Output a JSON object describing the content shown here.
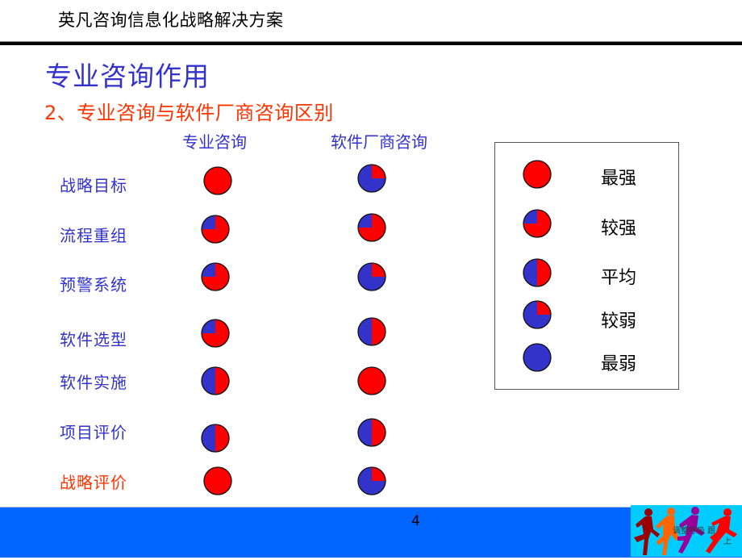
{
  "header": {
    "title": "英凡咨询信息化战略解决方案"
  },
  "slide": {
    "title": "专业咨询作用",
    "subtitle": "2、专业咨询与软件厂商咨询区别"
  },
  "comparison": {
    "columns": [
      "专业咨询",
      "软件厂商咨询"
    ],
    "rows": [
      {
        "label": "战略目标",
        "highlight": false,
        "ratings": [
          "最强",
          "较弱"
        ]
      },
      {
        "label": "流程重组",
        "highlight": false,
        "ratings": [
          "较强",
          "较强"
        ]
      },
      {
        "label": "预警系统",
        "highlight": false,
        "ratings": [
          "较强",
          "较弱"
        ]
      },
      {
        "label": "软件选型",
        "highlight": false,
        "ratings": [
          "较强",
          "平均"
        ]
      },
      {
        "label": "软件实施",
        "highlight": false,
        "ratings": [
          "平均",
          "最强"
        ]
      },
      {
        "label": "项目评价",
        "highlight": false,
        "ratings": [
          "平均",
          "平均"
        ]
      },
      {
        "label": "战略评价",
        "highlight": true,
        "ratings": [
          "最强",
          "较弱"
        ]
      }
    ]
  },
  "legend": {
    "items": [
      {
        "label": "最强",
        "red_fraction": 1.0
      },
      {
        "label": "较强",
        "red_fraction": 0.75
      },
      {
        "label": "平均",
        "red_fraction": 0.5
      },
      {
        "label": "较弱",
        "red_fraction": 0.25
      },
      {
        "label": "最弱",
        "red_fraction": 0.0
      }
    ]
  },
  "colors": {
    "strong": "#ff0000",
    "weak": "#3333cc",
    "title_blue": "#3333cc",
    "accent_red": "#ff3300",
    "footer_blue": "#0066ff",
    "logo_cyan": "#00ccff"
  },
  "footer": {
    "page_number": "4",
    "logo_text": "调整呼吸 跟",
    "logo_text2": "上"
  }
}
